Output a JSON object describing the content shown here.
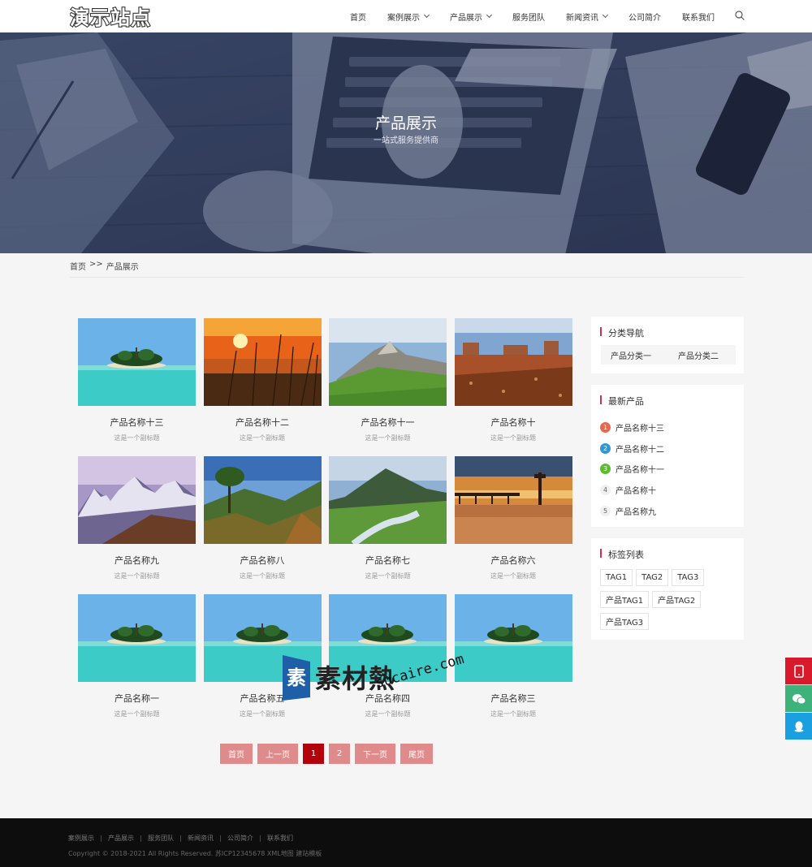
{
  "header": {
    "logo_text": "演示站点",
    "nav": [
      {
        "label": "首页",
        "dropdown": false
      },
      {
        "label": "案例展示",
        "dropdown": true
      },
      {
        "label": "产品展示",
        "dropdown": true
      },
      {
        "label": "服务团队",
        "dropdown": false
      },
      {
        "label": "新闻资讯",
        "dropdown": true
      },
      {
        "label": "公司简介",
        "dropdown": false
      },
      {
        "label": "联系我们",
        "dropdown": false
      }
    ]
  },
  "banner": {
    "title": "产品展示",
    "subtitle": "一站式服务提供商"
  },
  "breadcrumb": {
    "home": "首页",
    "separator": ">>",
    "current": "产品展示"
  },
  "products": [
    {
      "title": "产品名称十三",
      "subtitle": "这是一个副标题",
      "image": "island"
    },
    {
      "title": "产品名称十二",
      "subtitle": "这是一个副标题",
      "image": "sunset"
    },
    {
      "title": "产品名称十一",
      "subtitle": "这是一个副标题",
      "image": "mountain-green"
    },
    {
      "title": "产品名称十",
      "subtitle": "这是一个副标题",
      "image": "desert"
    },
    {
      "title": "产品名称九",
      "subtitle": "这是一个副标题",
      "image": "snow-mountain"
    },
    {
      "title": "产品名称八",
      "subtitle": "这是一个副标题",
      "image": "valley"
    },
    {
      "title": "产品名称七",
      "subtitle": "这是一个副标题",
      "image": "river"
    },
    {
      "title": "产品名称六",
      "subtitle": "这是一个副标题",
      "image": "pier"
    },
    {
      "title": "产品名称一",
      "subtitle": "这是一个副标题",
      "image": "island"
    },
    {
      "title": "产品名称五",
      "subtitle": "这是一个副标题",
      "image": "island"
    },
    {
      "title": "产品名称四",
      "subtitle": "这是一个副标题",
      "image": "island"
    },
    {
      "title": "产品名称三",
      "subtitle": "这是一个副标题",
      "image": "island"
    }
  ],
  "pagination": {
    "first": "首页",
    "prev": "上一页",
    "pages": [
      "1",
      "2"
    ],
    "current": "1",
    "next": "下一页",
    "last": "尾页"
  },
  "sidebar": {
    "categories": {
      "title": "分类导航",
      "items": [
        "产品分类一",
        "产品分类二"
      ]
    },
    "latest": {
      "title": "最新产品",
      "items": [
        {
          "rank": "1",
          "label": "产品名称十三",
          "color": "#e8674f"
        },
        {
          "rank": "2",
          "label": "产品名称十二",
          "color": "#2f97d3"
        },
        {
          "rank": "3",
          "label": "产品名称十一",
          "color": "#5bbd2b"
        },
        {
          "rank": "4",
          "label": "产品名称十",
          "color": ""
        },
        {
          "rank": "5",
          "label": "产品名称九",
          "color": ""
        }
      ]
    },
    "tags": {
      "title": "标签列表",
      "items": [
        "TAG1",
        "TAG2",
        "TAG3",
        "产品TAG1",
        "产品TAG2",
        "产品TAG3"
      ]
    }
  },
  "float_buttons": [
    {
      "icon": "mobile-phone-icon",
      "color": "#d9192c"
    },
    {
      "icon": "wechat-icon",
      "color": "#3db37b"
    },
    {
      "icon": "qq-icon",
      "color": "#1a9fe0"
    }
  ],
  "watermark": {
    "cn": "素材熱",
    "en": "sucaire.com"
  },
  "footer": {
    "links": [
      "案例展示",
      "产品展示",
      "服务团队",
      "新闻资讯",
      "公司简介",
      "联系我们"
    ],
    "copyright": "Copyright © 2018-2021 All Rights Reserved. 苏ICP12345678 XML地图 建站模板"
  },
  "colors": {
    "accent": "#d32f4a",
    "pager": "#e08b8b",
    "pager_active": "#b4020d",
    "footer_bg": "#0d0d0d"
  }
}
